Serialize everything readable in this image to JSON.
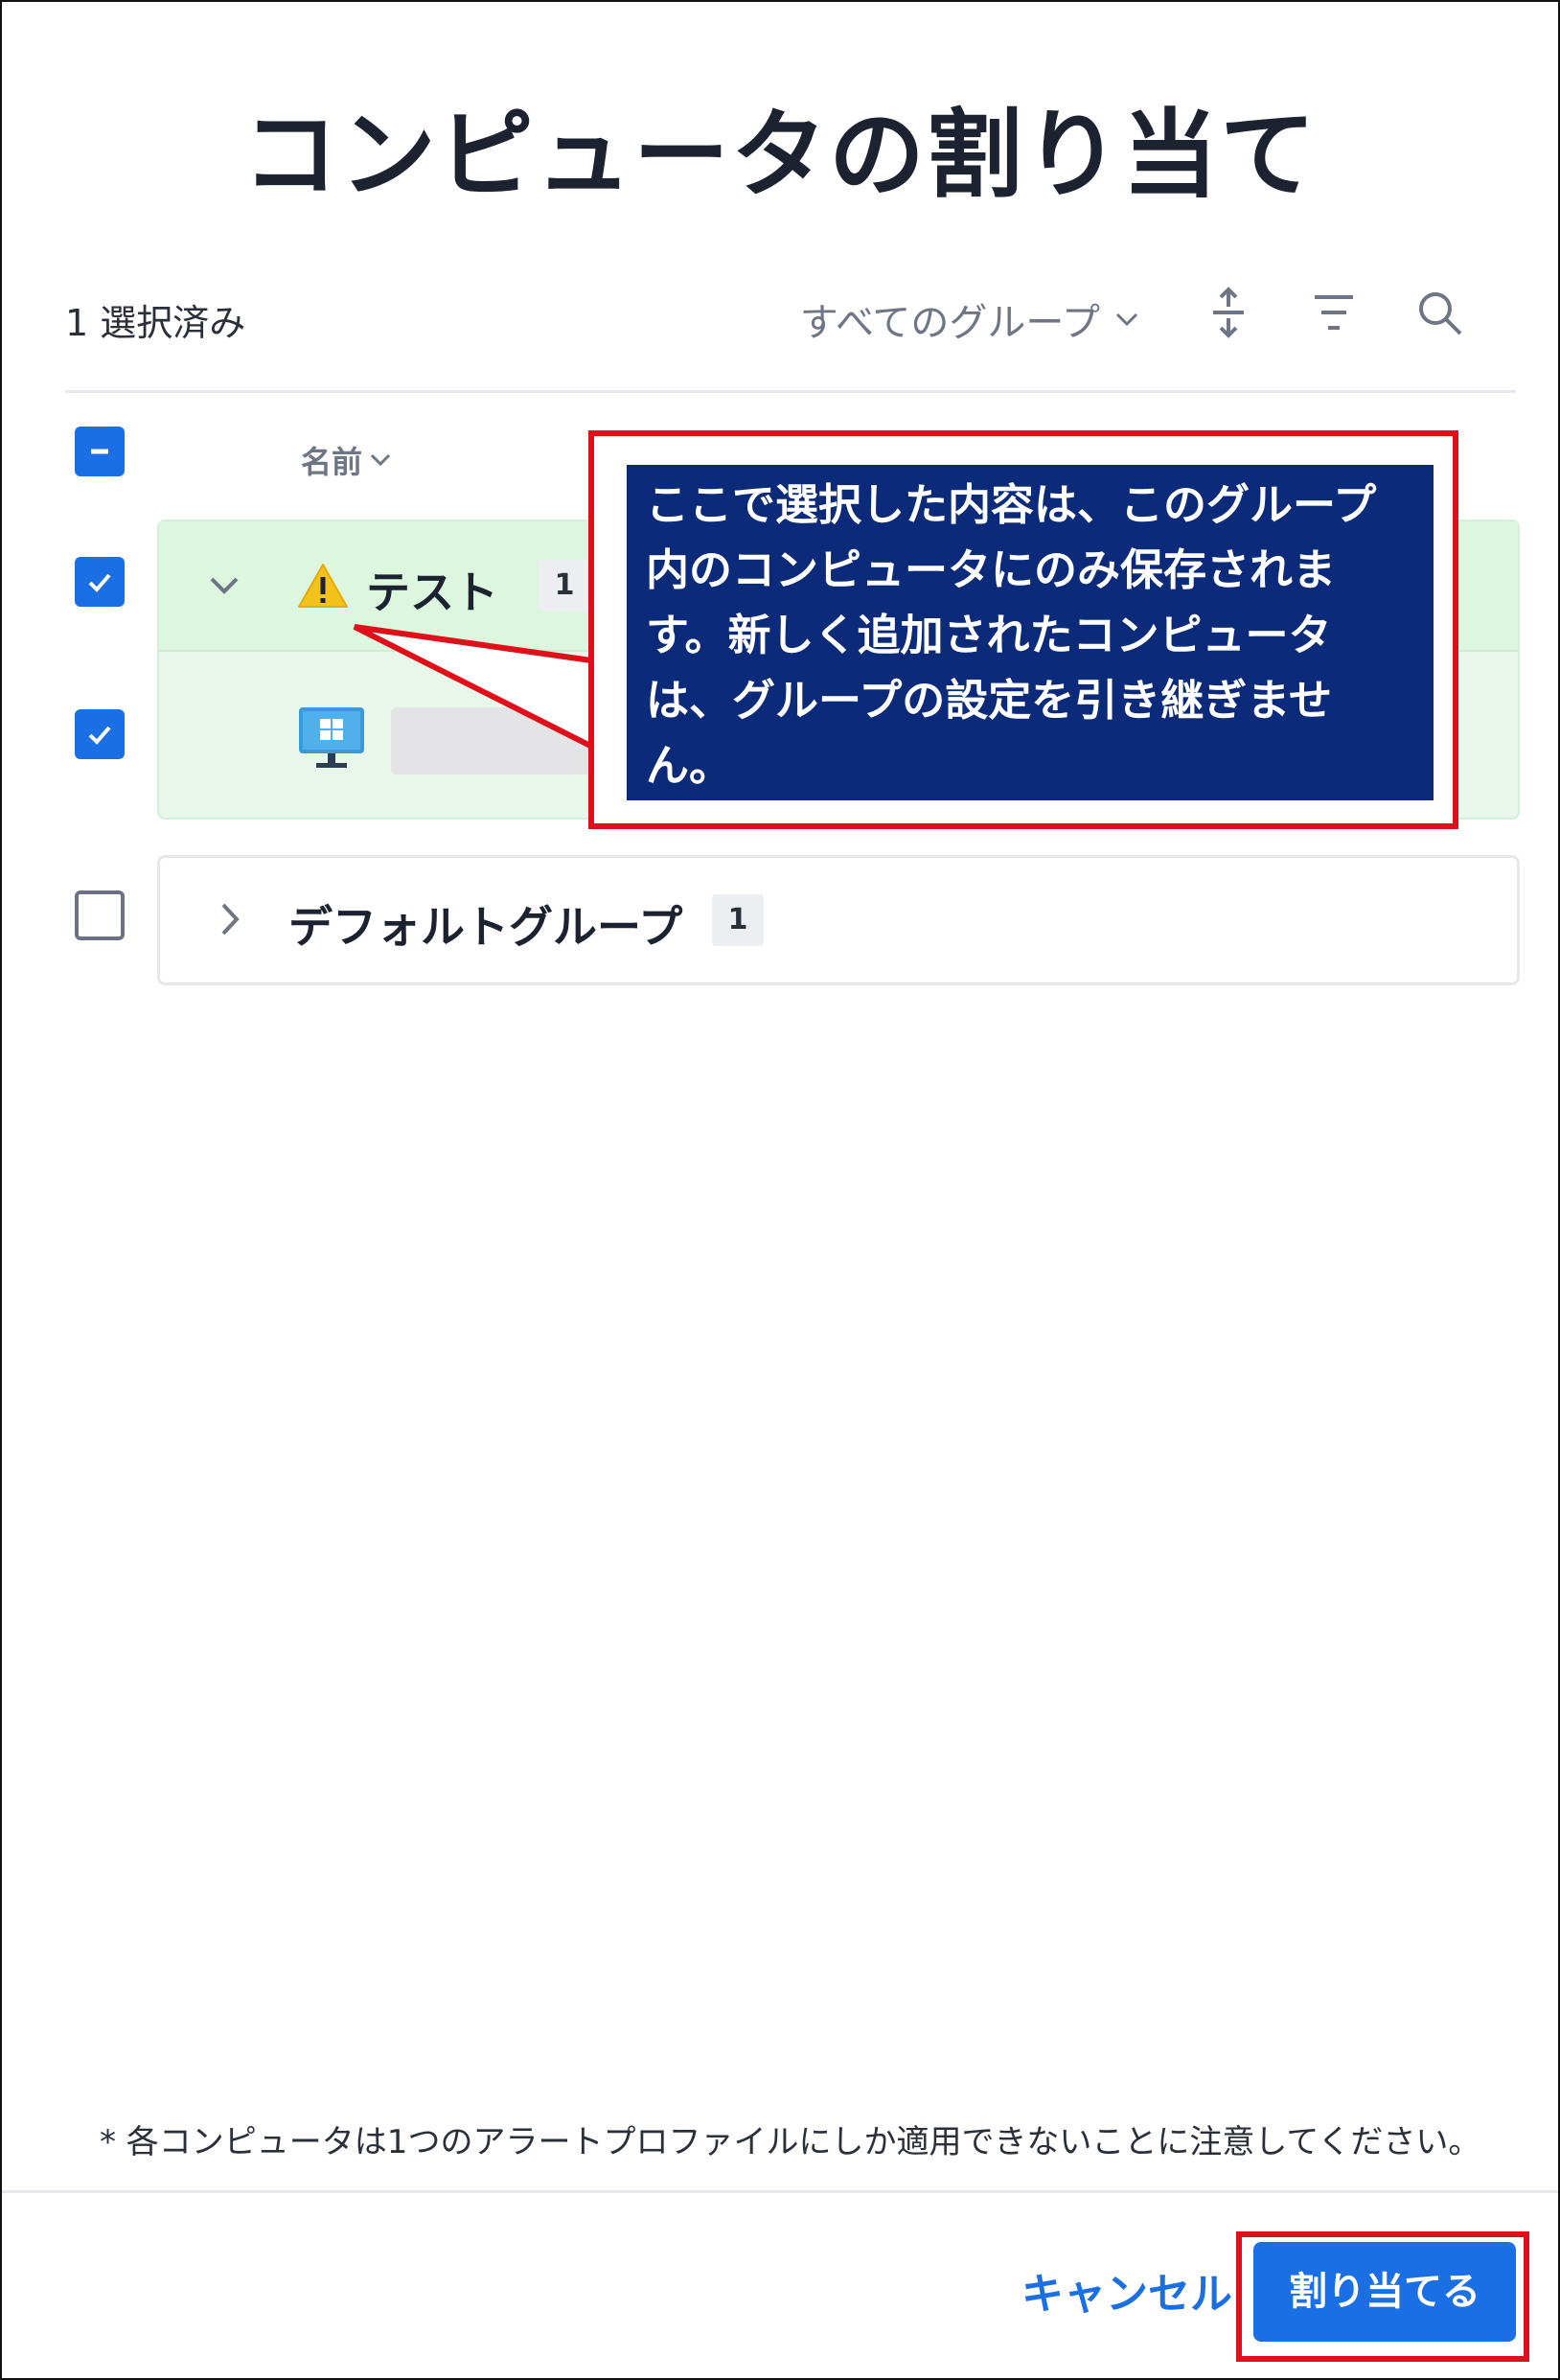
{
  "dialog": {
    "title": "コンピュータの割り当て"
  },
  "toolbar": {
    "selected_count": "1 選択済み",
    "group_filter_label": "すべてのグループ",
    "icons": [
      "expand-collapse-icon",
      "filter-icon",
      "search-icon"
    ]
  },
  "table": {
    "name_column": "名前"
  },
  "groups": [
    {
      "name": "テスト",
      "count": "1",
      "checked": true,
      "expanded": true,
      "warning": true,
      "computers": [
        {
          "os_icon": "windows-monitor-icon",
          "checked": true
        }
      ]
    },
    {
      "name": "デフォルトグループ",
      "count": "1",
      "checked": false,
      "expanded": false
    }
  ],
  "callout": {
    "text": "ここで選択した内容は、このグループ内のコンピュータにのみ保存されます。新しく追加されたコンピュータは、グループの設定を引き継ぎません。"
  },
  "footnote": "* 各コンピュータは1つのアラートプロファイルにしか適用できないことに注意してください。",
  "actions": {
    "cancel": "キャンセル",
    "assign": "割り当てる"
  },
  "colors": {
    "accent": "#1a6fe5",
    "callout_bg": "#0b2b7a",
    "highlight_border": "#e0101a",
    "group_bg": "#e9f7eb"
  }
}
